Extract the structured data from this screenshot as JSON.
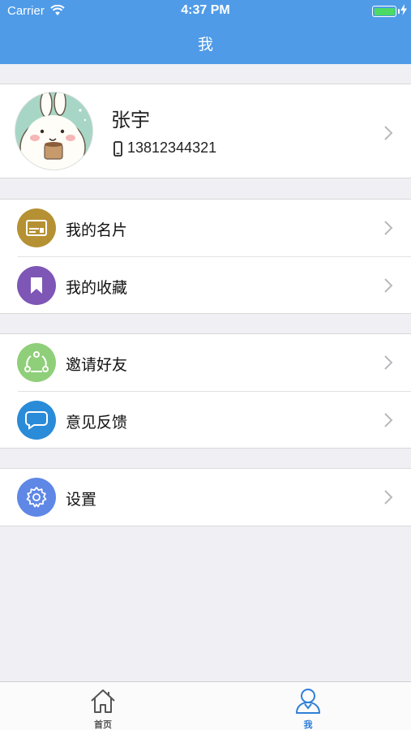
{
  "status_bar": {
    "carrier": "Carrier",
    "time": "4:37 PM"
  },
  "nav": {
    "title": "我"
  },
  "profile": {
    "name": "张宇",
    "phone": "13812344321"
  },
  "menu_groups": [
    {
      "items": [
        {
          "label": "我的名片",
          "icon": "card-icon",
          "color": "#b69133"
        },
        {
          "label": "我的收藏",
          "icon": "bookmark-icon",
          "color": "#7e56b5"
        }
      ]
    },
    {
      "items": [
        {
          "label": "邀请好友",
          "icon": "share-icon",
          "color": "#8fcf79"
        },
        {
          "label": "意见反馈",
          "icon": "chat-bubble-icon",
          "color": "#2a8bd8"
        }
      ]
    },
    {
      "items": [
        {
          "label": "设置",
          "icon": "gear-icon",
          "color": "#5f87e6"
        }
      ]
    }
  ],
  "tab_bar": {
    "home_label": "首页",
    "me_label": "我",
    "active_tab": "我",
    "active_color": "#2f7fd8",
    "inactive_color": "#555555"
  },
  "colors": {
    "header": "#4f9be8",
    "background": "#efeff4"
  }
}
